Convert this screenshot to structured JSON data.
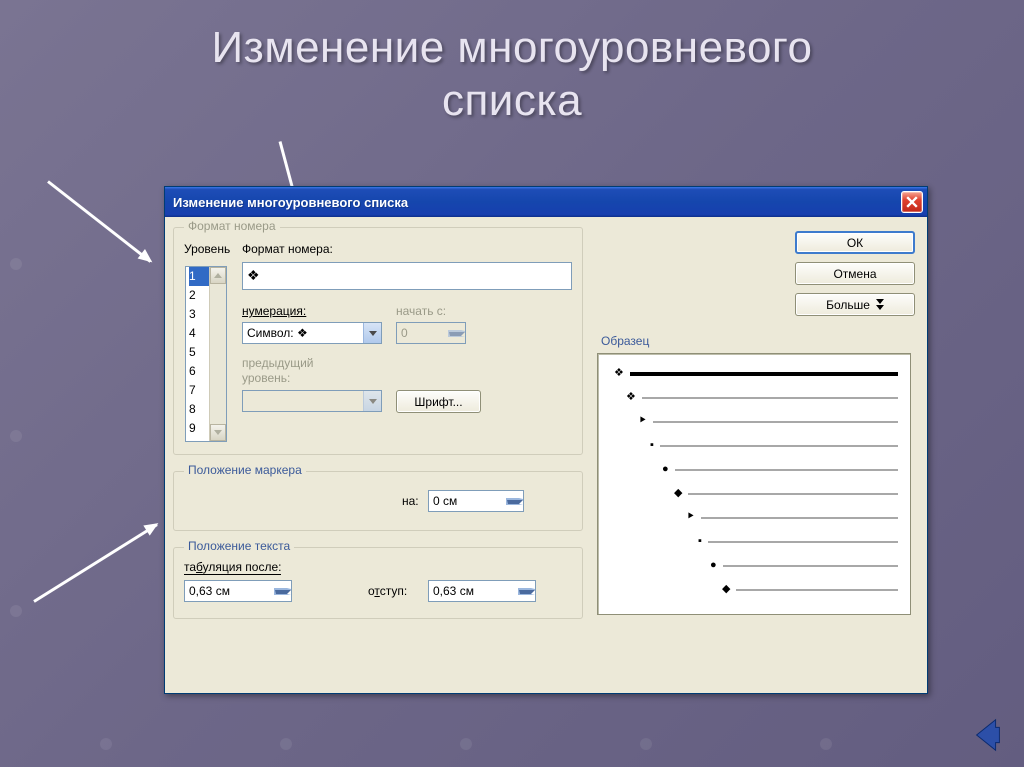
{
  "slide": {
    "title_line1": "Изменение многоуровневого",
    "title_line2": "списка"
  },
  "dialog": {
    "title": "Изменение многоуровневого списка",
    "buttons": {
      "ok": "ОК",
      "cancel": "Отмена",
      "more": "Больше",
      "font": "Шрифт..."
    },
    "group_format": {
      "legend": "Формат номера",
      "level_label": "Уровень",
      "format_label": "Формат номера:",
      "format_value": "❖",
      "numbering_label": "нумерация:",
      "numbering_value": "Символ:  ❖",
      "start_label": "начать с:",
      "start_value": "0",
      "prev_label_line1": "предыдущий",
      "prev_label_line2": "уровень:",
      "prev_value": "",
      "levels": [
        "1",
        "2",
        "3",
        "4",
        "5",
        "6",
        "7",
        "8",
        "9"
      ]
    },
    "group_marker": {
      "legend": "Положение маркера",
      "at_label": "на:",
      "at_value": "0 см"
    },
    "group_text": {
      "legend": "Положение текста",
      "tab_label": "табуляция после:",
      "tab_value": "0,63 см",
      "indent_label": "отступ:",
      "indent_value": "0,63 см"
    },
    "preview": {
      "legend": "Образец",
      "bullets": [
        "❖",
        "❖",
        "⯈",
        "▪",
        "●",
        "◆",
        "⯈",
        "▪",
        "●",
        "◆"
      ]
    }
  }
}
